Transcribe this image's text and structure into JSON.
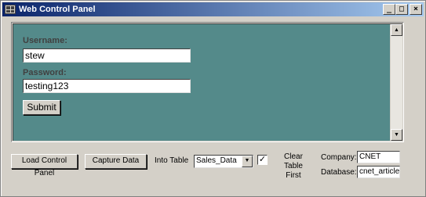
{
  "window": {
    "title": "Web Control Panel",
    "minimize_glyph": "_",
    "maximize_glyph": "□",
    "close_glyph": "×"
  },
  "form": {
    "username_label": "Username:",
    "username_value": "stew",
    "password_label": "Password:",
    "password_value": "testing123",
    "submit_label": "Submit"
  },
  "scrollbar": {
    "up_arrow": "▲",
    "down_arrow": "▼"
  },
  "toolbar": {
    "load_label": "Load Control Panel",
    "capture_label": "Capture Data",
    "into_table_label": "Into Table",
    "table_selected": "Sales_Data",
    "table_arrow": "▼",
    "clear_table_checked": true,
    "clear_table_check_glyph": "✓",
    "clear_table_label_line1": "Clear Table",
    "clear_table_label_line2": "First",
    "company_label": "Company:",
    "company_value": "CNET",
    "database_label": "Database:",
    "database_value": "cnet_articles"
  }
}
